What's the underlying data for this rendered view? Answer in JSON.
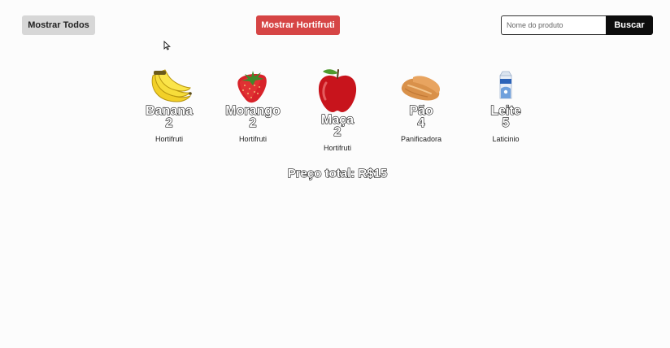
{
  "toolbar": {
    "show_all_label": "Mostrar Todos",
    "show_horti_label": "Mostrar Hortifruti",
    "search_placeholder": "Nome do produto",
    "search_value": "",
    "search_button_label": "Buscar"
  },
  "products": [
    {
      "name": "Banana",
      "quantity": "2",
      "category": "Hortifruti",
      "icon": "banana-icon"
    },
    {
      "name": "Morango",
      "quantity": "2",
      "category": "Hortifruti",
      "icon": "strawberry-icon"
    },
    {
      "name": "Maça",
      "quantity": "2",
      "category": "Hortifruti",
      "icon": "apple-icon"
    },
    {
      "name": "Pão",
      "quantity": "4",
      "category": "Panificadora",
      "icon": "bread-icon"
    },
    {
      "name": "Leite",
      "quantity": "5",
      "category": "Laticinio",
      "icon": "milk-icon"
    }
  ],
  "total": {
    "label": "Preço total: R$15"
  },
  "colors": {
    "horti_button": "#d64545",
    "search_button": "#0d0d0d",
    "neutral_button": "#d7d7d7"
  }
}
